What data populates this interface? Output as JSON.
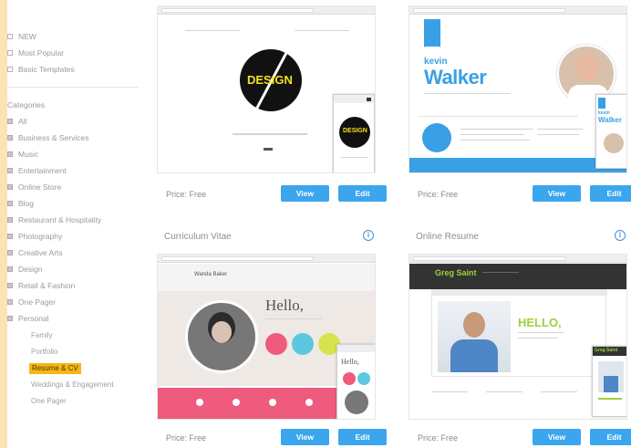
{
  "sidebar": {
    "filters": [
      {
        "label": "NEW"
      },
      {
        "label": "Most Popular"
      },
      {
        "label": "Basic Templates"
      }
    ],
    "categories_heading": "Categories",
    "categories": [
      {
        "label": "All"
      },
      {
        "label": "Business & Services"
      },
      {
        "label": "Music"
      },
      {
        "label": "Entertainment"
      },
      {
        "label": "Online Store"
      },
      {
        "label": "Blog"
      },
      {
        "label": "Restaurant & Hospitality"
      },
      {
        "label": "Photography"
      },
      {
        "label": "Creative Arts"
      },
      {
        "label": "Design"
      },
      {
        "label": "Retail & Fashion"
      },
      {
        "label": "One Pager"
      },
      {
        "label": "Personal"
      }
    ],
    "subcategories": [
      {
        "label": "Family",
        "active": false
      },
      {
        "label": "Portfolio",
        "active": false
      },
      {
        "label": "Resume & CV",
        "active": true
      },
      {
        "label": "Weddings & Engagement",
        "active": false
      },
      {
        "label": "One Pager",
        "active": false
      }
    ]
  },
  "cards": [
    {
      "title": "",
      "price": "Price: Free",
      "view_label": "View",
      "edit_label": "Edit",
      "preview": {
        "logo_text": "DESIGN"
      }
    },
    {
      "title": "",
      "price": "Price: Free",
      "view_label": "View",
      "edit_label": "Edit",
      "preview": {
        "first_name": "kevin",
        "last_name": "Walker"
      }
    },
    {
      "title": "Curriculum Vitae",
      "price": "Price: Free",
      "view_label": "View",
      "edit_label": "Edit",
      "preview": {
        "name": "Wanda Baker",
        "greeting": "Hello,",
        "phone_greeting": "Hello,"
      }
    },
    {
      "title": "Online Resume",
      "price": "Price: Free",
      "view_label": "View",
      "edit_label": "Edit",
      "preview": {
        "name": "Greg Saint",
        "greeting": "HELLO,"
      }
    }
  ],
  "colors": {
    "accent_blue": "#3ba6ee",
    "active_highlight": "#f4b716",
    "page_background": "#fbe3b6"
  }
}
